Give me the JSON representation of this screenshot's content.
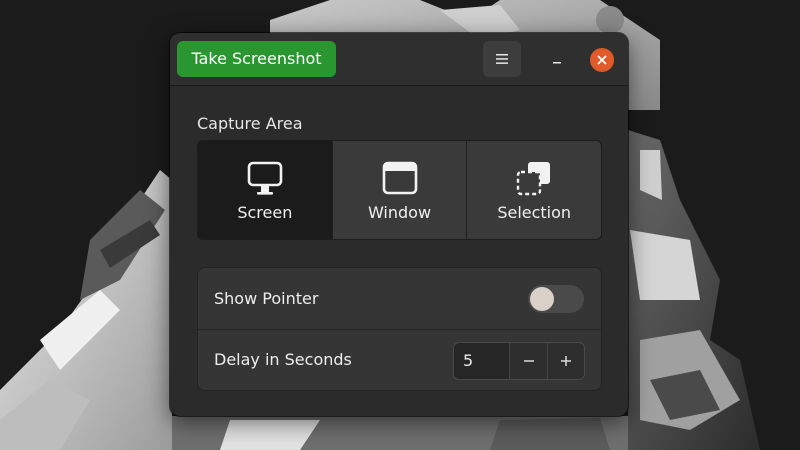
{
  "header": {
    "primary_button": "Take Screenshot",
    "menu_icon": "hamburger-menu-icon",
    "minimize_icon": "minimize-icon",
    "close_icon": "close-icon"
  },
  "capture_area": {
    "title": "Capture Area",
    "options": [
      {
        "label": "Screen",
        "icon": "monitor-icon",
        "selected": true
      },
      {
        "label": "Window",
        "icon": "window-icon",
        "selected": false
      },
      {
        "label": "Selection",
        "icon": "selection-icon",
        "selected": false
      }
    ]
  },
  "settings": {
    "show_pointer": {
      "label": "Show Pointer",
      "enabled": false
    },
    "delay": {
      "label": "Delay in Seconds",
      "value": "5",
      "decrement_icon": "minus-icon",
      "increment_icon": "plus-icon"
    }
  },
  "colors": {
    "accent_green": "#2a9630",
    "close_orange": "#e05a2a",
    "window_bg": "#2b2b2b"
  }
}
